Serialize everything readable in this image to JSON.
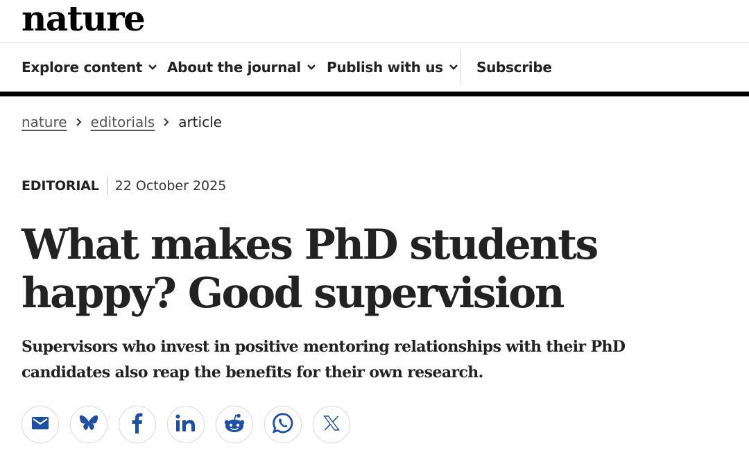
{
  "brand": {
    "logo_text": "nature"
  },
  "nav": {
    "items": [
      {
        "label": "Explore content",
        "dropdown": true
      },
      {
        "label": "About the journal",
        "dropdown": true
      },
      {
        "label": "Publish with us",
        "dropdown": true
      }
    ],
    "subscribe_label": "Subscribe"
  },
  "breadcrumb": {
    "items": [
      "nature",
      "editorials"
    ],
    "current": "article"
  },
  "article": {
    "type": "EDITORIAL",
    "date": "22 October 2025",
    "title": "What makes PhD students happy? Good supervision",
    "standfirst": "Supervisors who invest in positive mentoring relationships with their PhD candidates also reap the benefits for their own research."
  },
  "share": {
    "buttons": [
      "email-icon",
      "bluesky-icon",
      "facebook-icon",
      "linkedin-icon",
      "reddit-icon",
      "whatsapp-icon",
      "x-icon"
    ],
    "brand_colors": {
      "bluesky": "#1d4fa3",
      "facebook": "#1d4fa3",
      "linkedin": "#1d4fa3",
      "reddit": "#1d4fa3",
      "whatsapp": "#1d4fa3",
      "email": "#1d4fa3",
      "x": "#1d4fa3"
    }
  },
  "colors": {
    "text": "#222222",
    "nav_underline": "#000000",
    "icon_blue": "#1d4fa3"
  }
}
